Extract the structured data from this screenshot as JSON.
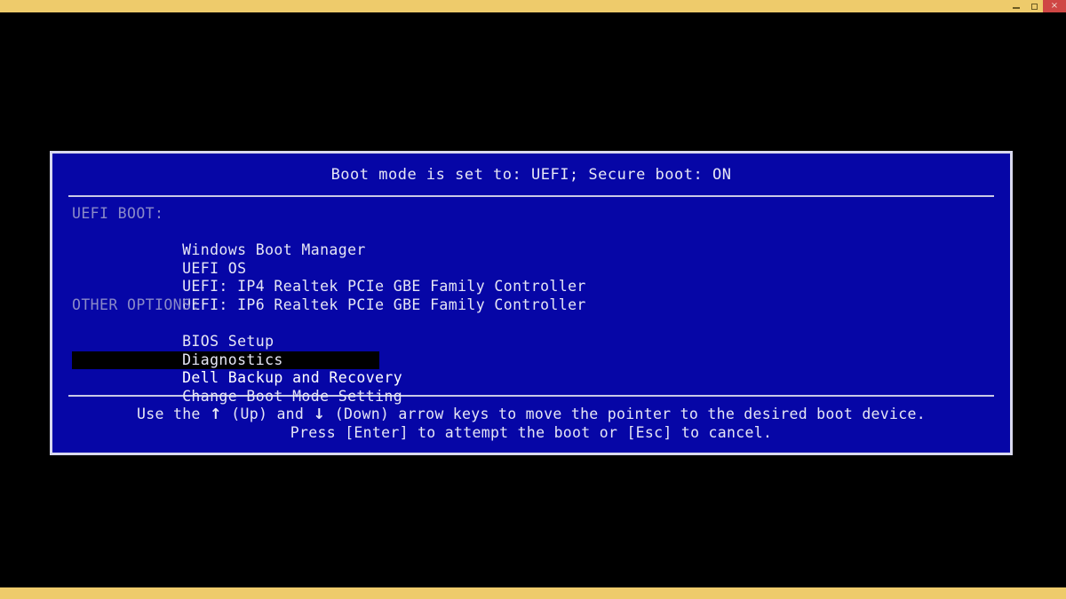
{
  "window": {
    "controls": [
      {
        "name": "minimize",
        "glyph": ""
      },
      {
        "name": "maximize",
        "glyph": ""
      },
      {
        "name": "close",
        "glyph": "×"
      }
    ],
    "chrome_color": "#eecb6b",
    "close_color": "#cf4644"
  },
  "dialog": {
    "header": "Boot mode is set to: UEFI; Secure boot: ON",
    "background_color": "#0606a6",
    "border_color": "#d8d8ee",
    "text_color": "#e6e6f5",
    "section_header_color": "#8a8ac8",
    "selected_background": "#000000",
    "selected_text_color": "#ffffff",
    "sections": [
      {
        "title": "UEFI BOOT:",
        "items": [
          {
            "label": "Windows Boot Manager",
            "selected": false
          },
          {
            "label": "UEFI OS",
            "selected": false
          },
          {
            "label": "UEFI: IP4 Realtek PCIe GBE Family Controller",
            "selected": false
          },
          {
            "label": "UEFI: IP6 Realtek PCIe GBE Family Controller",
            "selected": false
          }
        ]
      },
      {
        "title": "OTHER OPTIONS:",
        "items": [
          {
            "label": "BIOS Setup",
            "selected": false
          },
          {
            "label": "Diagnostics",
            "selected": false
          },
          {
            "label": "Dell Backup and Recovery",
            "selected": true
          },
          {
            "label": "Change Boot Mode Setting",
            "selected": false
          }
        ]
      }
    ],
    "footer": {
      "line1_part1": "Use the ",
      "line1_up_arrow": "↑",
      "line1_part2": " (Up) and ",
      "line1_down_arrow": "↓",
      "line1_part3": " (Down) arrow keys to move the pointer to the desired boot device.",
      "line2": "Press [Enter] to attempt the boot or [Esc] to cancel."
    }
  }
}
